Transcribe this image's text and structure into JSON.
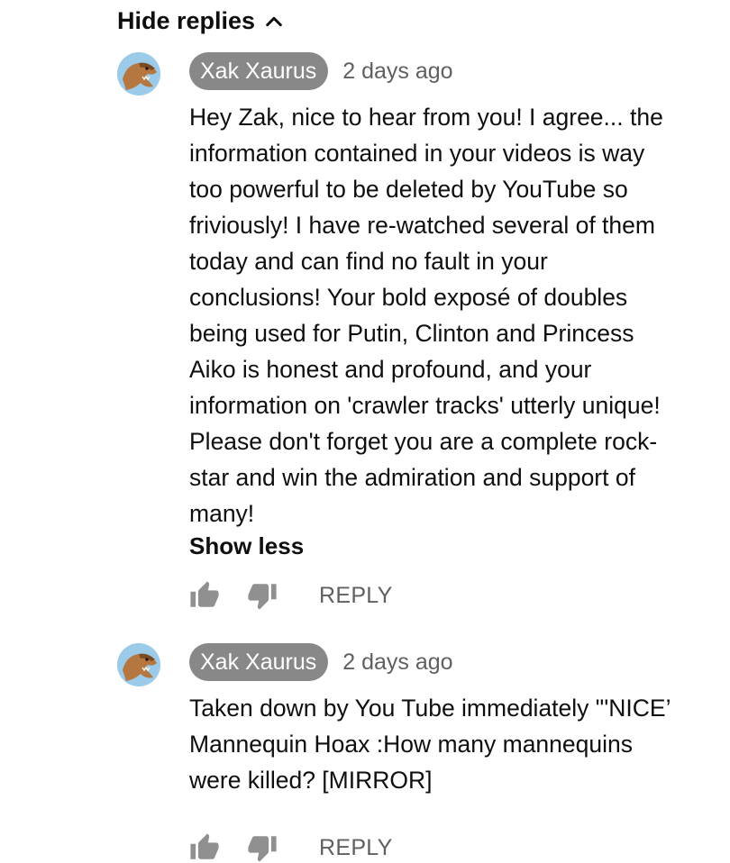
{
  "thread": {
    "hide_replies_label": "Hide replies"
  },
  "comments": [
    {
      "author": "Xak Xaurus",
      "timestamp": "2 days ago",
      "text": "Hey Zak, nice to hear from you! I agree... the\ninformation contained in your videos is way\ntoo powerful to be deleted by YouTube so\nfriviously! I have re-watched several of them\ntoday and can find no fault in your\nconclusions! Your bold exposé of doubles\nbeing used for Putin, Clinton and Princess\nAiko is honest and profound, and your\ninformation on 'crawler tracks' utterly unique!\nPlease don't forget you are a complete rock-\nstar and win the admiration and support of\nmany!",
      "show_less_label": "Show less",
      "reply_label": "REPLY"
    },
    {
      "author": "Xak Xaurus",
      "timestamp": "2 days ago",
      "text": "Taken down by You Tube immediately \"'NICE’\nMannequin Hoax :How many mannequins\nwere killed?  [MIRROR]",
      "reply_label": "REPLY"
    }
  ],
  "icons": {
    "chevron": "chevron-up-icon",
    "like": "thumbs-up-icon",
    "dislike": "thumbs-down-icon",
    "avatar": "dinosaur-avatar"
  },
  "colors": {
    "author_chip_bg": "#888888",
    "secondary_text": "#606060",
    "primary_text": "#0f0f0f",
    "icon_gray": "#909090"
  }
}
